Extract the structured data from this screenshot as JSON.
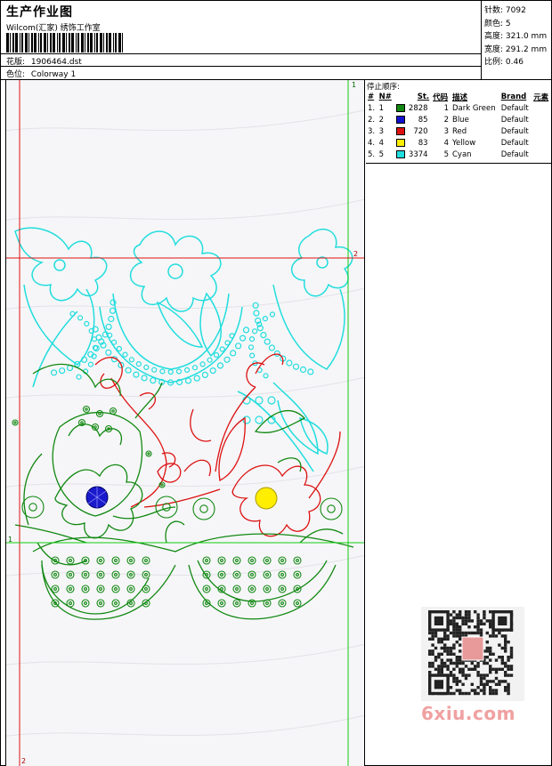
{
  "header": {
    "title": "生产作业图",
    "studio": "Wilcom(汇家) 绣饰工作室",
    "pattern_label": "花版:",
    "pattern_value": "1906464.dst",
    "color_label": "色位:",
    "color_value": "Colorway 1"
  },
  "stats": [
    {
      "label": "针数",
      "value": "7092"
    },
    {
      "label": "颜色",
      "value": "5"
    },
    {
      "label": "高度",
      "value": "321.0 mm"
    },
    {
      "label": "宽度",
      "value": "291.2 mm"
    },
    {
      "label": "比例",
      "value": "0.46"
    }
  ],
  "stop_sequence": {
    "title": "停止顺序:",
    "columns": [
      "#",
      "N#",
      "St.",
      "代码",
      "描述",
      "Brand",
      "元素"
    ],
    "rows": [
      {
        "n": "1.",
        "nn": "1",
        "color": "#118811",
        "stitches": "2828",
        "code": "1",
        "desc": "Dark Green",
        "brand": "Default"
      },
      {
        "n": "2.",
        "nn": "2",
        "color": "#1111cc",
        "stitches": "85",
        "code": "2",
        "desc": "Blue",
        "brand": "Default"
      },
      {
        "n": "3.",
        "nn": "3",
        "color": "#dd1111",
        "stitches": "720",
        "code": "3",
        "desc": "Red",
        "brand": "Default"
      },
      {
        "n": "4.",
        "nn": "4",
        "color": "#ffee00",
        "stitches": "83",
        "code": "4",
        "desc": "Yellow",
        "brand": "Default"
      },
      {
        "n": "5.",
        "nn": "5",
        "color": "#22dddd",
        "stitches": "3374",
        "code": "5",
        "desc": "Cyan",
        "brand": "Default"
      }
    ]
  },
  "markers": {
    "top_right": "1",
    "mid_right": "2",
    "bottom_left": "2",
    "mid_left": "1"
  },
  "colors": {
    "green": "#118811",
    "blue": "#1111cc",
    "red": "#dd1111",
    "yellow": "#ffee00",
    "cyan": "#22dddd"
  },
  "watermark": "6xiu.com"
}
